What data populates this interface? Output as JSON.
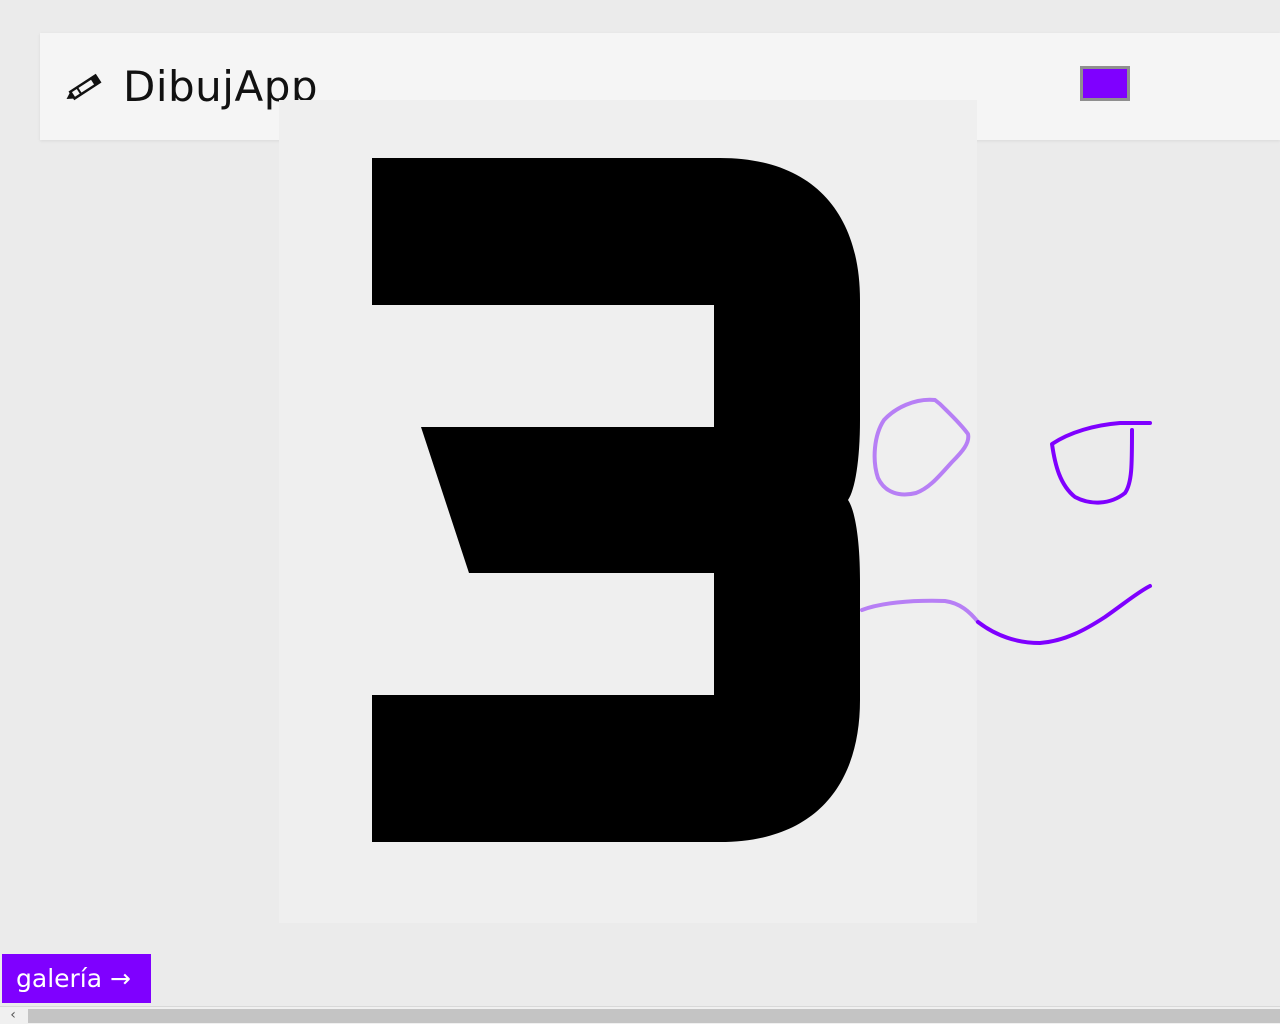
{
  "app": {
    "title": "DibujApp",
    "brand_icon": "pencil-icon"
  },
  "toolbar": {
    "selected_color": "#7f00ff",
    "swatch_border": "#8f8f8f"
  },
  "canvas": {
    "background": "#efefef",
    "drawn_shapes": [
      "digit-3-glyph",
      "circle-stroke",
      "cup-stroke",
      "wave-stroke"
    ]
  },
  "gallery_button": {
    "label": "galería →"
  },
  "scrollbar": {
    "left_arrow": "‹",
    "left_arrow_icon": "chevron-left-icon"
  },
  "colors": {
    "accent": "#7f00ff",
    "stroke_light": "#b77ff5",
    "ink": "#000000"
  }
}
